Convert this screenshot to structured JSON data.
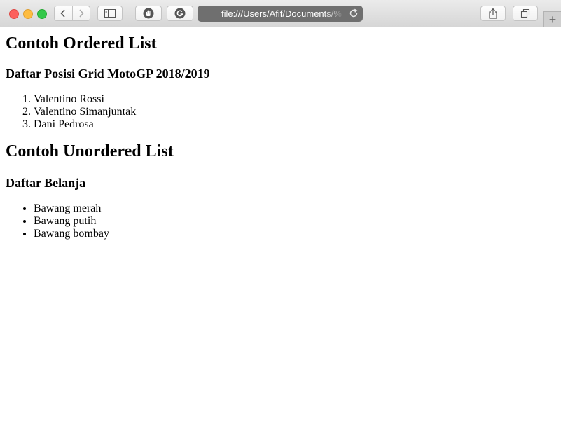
{
  "browser": {
    "address": "file:///Users/Afif/Documents/%",
    "new_tab_symbol": "+",
    "icons": {
      "back": "chevron-left-icon",
      "forward": "chevron-right-icon",
      "sidebar": "sidebar-icon",
      "extension_1": "hand-stop-icon",
      "extension_2": "grammarly-icon",
      "reload": "reload-icon",
      "share": "share-icon",
      "tabs": "tabs-overview-icon"
    },
    "colors": {
      "close": "#fc605c",
      "minimize": "#fdbc40",
      "zoom": "#34c84a"
    }
  },
  "page": {
    "ordered_heading": "Contoh Ordered List",
    "ordered_subheading": "Daftar Posisi Grid MotoGP 2018/2019",
    "ordered_items": [
      "Valentino Rossi",
      "Valentino Simanjuntak",
      "Dani Pedrosa"
    ],
    "unordered_heading": "Contoh Unordered List",
    "unordered_subheading": "Daftar Belanja",
    "unordered_items": [
      "Bawang merah",
      "Bawang putih",
      "Bawang bombay"
    ]
  }
}
